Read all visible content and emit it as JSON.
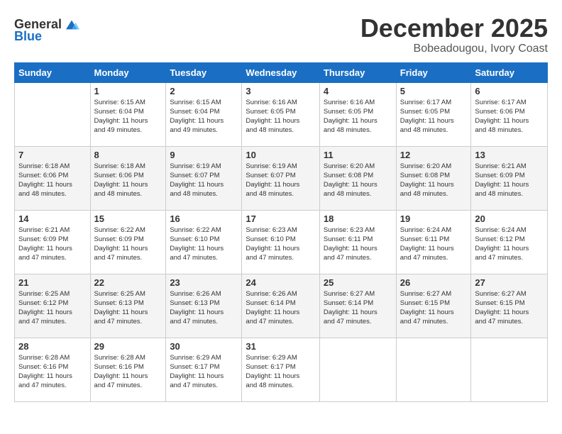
{
  "header": {
    "logo_general": "General",
    "logo_blue": "Blue",
    "month_title": "December 2025",
    "location": "Bobeadougou, Ivory Coast"
  },
  "days_of_week": [
    "Sunday",
    "Monday",
    "Tuesday",
    "Wednesday",
    "Thursday",
    "Friday",
    "Saturday"
  ],
  "weeks": [
    [
      {
        "day": "",
        "info": ""
      },
      {
        "day": "1",
        "info": "Sunrise: 6:15 AM\nSunset: 6:04 PM\nDaylight: 11 hours\nand 49 minutes."
      },
      {
        "day": "2",
        "info": "Sunrise: 6:15 AM\nSunset: 6:04 PM\nDaylight: 11 hours\nand 49 minutes."
      },
      {
        "day": "3",
        "info": "Sunrise: 6:16 AM\nSunset: 6:05 PM\nDaylight: 11 hours\nand 48 minutes."
      },
      {
        "day": "4",
        "info": "Sunrise: 6:16 AM\nSunset: 6:05 PM\nDaylight: 11 hours\nand 48 minutes."
      },
      {
        "day": "5",
        "info": "Sunrise: 6:17 AM\nSunset: 6:05 PM\nDaylight: 11 hours\nand 48 minutes."
      },
      {
        "day": "6",
        "info": "Sunrise: 6:17 AM\nSunset: 6:06 PM\nDaylight: 11 hours\nand 48 minutes."
      }
    ],
    [
      {
        "day": "7",
        "info": "Sunrise: 6:18 AM\nSunset: 6:06 PM\nDaylight: 11 hours\nand 48 minutes."
      },
      {
        "day": "8",
        "info": "Sunrise: 6:18 AM\nSunset: 6:06 PM\nDaylight: 11 hours\nand 48 minutes."
      },
      {
        "day": "9",
        "info": "Sunrise: 6:19 AM\nSunset: 6:07 PM\nDaylight: 11 hours\nand 48 minutes."
      },
      {
        "day": "10",
        "info": "Sunrise: 6:19 AM\nSunset: 6:07 PM\nDaylight: 11 hours\nand 48 minutes."
      },
      {
        "day": "11",
        "info": "Sunrise: 6:20 AM\nSunset: 6:08 PM\nDaylight: 11 hours\nand 48 minutes."
      },
      {
        "day": "12",
        "info": "Sunrise: 6:20 AM\nSunset: 6:08 PM\nDaylight: 11 hours\nand 48 minutes."
      },
      {
        "day": "13",
        "info": "Sunrise: 6:21 AM\nSunset: 6:09 PM\nDaylight: 11 hours\nand 48 minutes."
      }
    ],
    [
      {
        "day": "14",
        "info": "Sunrise: 6:21 AM\nSunset: 6:09 PM\nDaylight: 11 hours\nand 47 minutes."
      },
      {
        "day": "15",
        "info": "Sunrise: 6:22 AM\nSunset: 6:09 PM\nDaylight: 11 hours\nand 47 minutes."
      },
      {
        "day": "16",
        "info": "Sunrise: 6:22 AM\nSunset: 6:10 PM\nDaylight: 11 hours\nand 47 minutes."
      },
      {
        "day": "17",
        "info": "Sunrise: 6:23 AM\nSunset: 6:10 PM\nDaylight: 11 hours\nand 47 minutes."
      },
      {
        "day": "18",
        "info": "Sunrise: 6:23 AM\nSunset: 6:11 PM\nDaylight: 11 hours\nand 47 minutes."
      },
      {
        "day": "19",
        "info": "Sunrise: 6:24 AM\nSunset: 6:11 PM\nDaylight: 11 hours\nand 47 minutes."
      },
      {
        "day": "20",
        "info": "Sunrise: 6:24 AM\nSunset: 6:12 PM\nDaylight: 11 hours\nand 47 minutes."
      }
    ],
    [
      {
        "day": "21",
        "info": "Sunrise: 6:25 AM\nSunset: 6:12 PM\nDaylight: 11 hours\nand 47 minutes."
      },
      {
        "day": "22",
        "info": "Sunrise: 6:25 AM\nSunset: 6:13 PM\nDaylight: 11 hours\nand 47 minutes."
      },
      {
        "day": "23",
        "info": "Sunrise: 6:26 AM\nSunset: 6:13 PM\nDaylight: 11 hours\nand 47 minutes."
      },
      {
        "day": "24",
        "info": "Sunrise: 6:26 AM\nSunset: 6:14 PM\nDaylight: 11 hours\nand 47 minutes."
      },
      {
        "day": "25",
        "info": "Sunrise: 6:27 AM\nSunset: 6:14 PM\nDaylight: 11 hours\nand 47 minutes."
      },
      {
        "day": "26",
        "info": "Sunrise: 6:27 AM\nSunset: 6:15 PM\nDaylight: 11 hours\nand 47 minutes."
      },
      {
        "day": "27",
        "info": "Sunrise: 6:27 AM\nSunset: 6:15 PM\nDaylight: 11 hours\nand 47 minutes."
      }
    ],
    [
      {
        "day": "28",
        "info": "Sunrise: 6:28 AM\nSunset: 6:16 PM\nDaylight: 11 hours\nand 47 minutes."
      },
      {
        "day": "29",
        "info": "Sunrise: 6:28 AM\nSunset: 6:16 PM\nDaylight: 11 hours\nand 47 minutes."
      },
      {
        "day": "30",
        "info": "Sunrise: 6:29 AM\nSunset: 6:17 PM\nDaylight: 11 hours\nand 47 minutes."
      },
      {
        "day": "31",
        "info": "Sunrise: 6:29 AM\nSunset: 6:17 PM\nDaylight: 11 hours\nand 48 minutes."
      },
      {
        "day": "",
        "info": ""
      },
      {
        "day": "",
        "info": ""
      },
      {
        "day": "",
        "info": ""
      }
    ]
  ]
}
